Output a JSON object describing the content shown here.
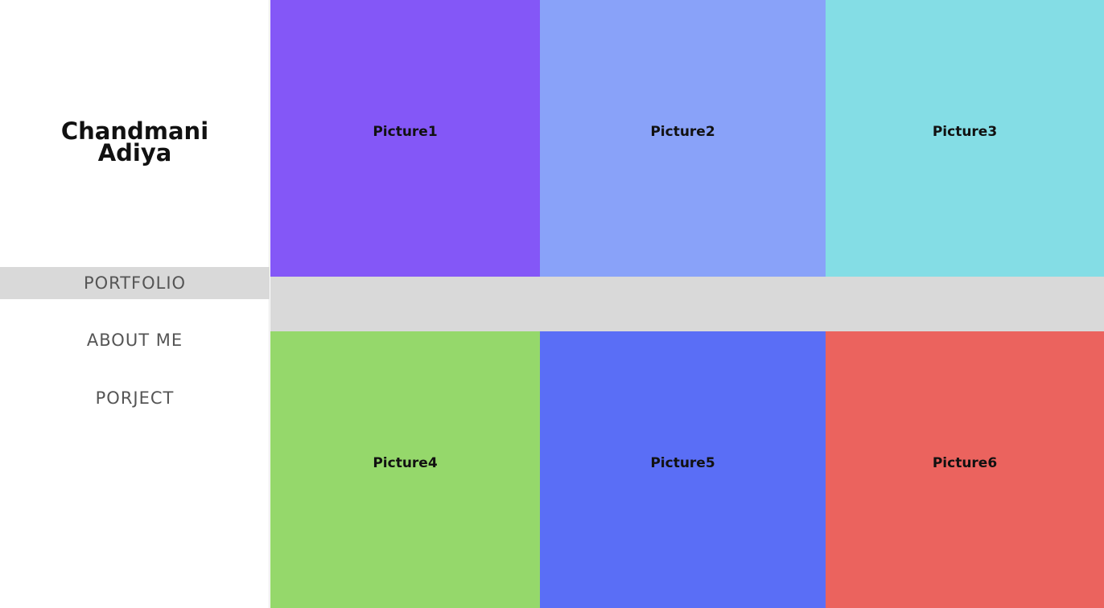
{
  "brand": {
    "line1": "Chandmani",
    "line2": "Adiya"
  },
  "nav": {
    "items": [
      {
        "label": "PORTFOLIO",
        "active": true
      },
      {
        "label": "ABOUT ME",
        "active": false
      },
      {
        "label": "PORJECT",
        "active": false
      }
    ]
  },
  "gallery": {
    "tiles": [
      {
        "label": "Picture1",
        "color": "#8457f7"
      },
      {
        "label": "Picture2",
        "color": "#89a2f9"
      },
      {
        "label": "Picture3",
        "color": "#84dde5"
      },
      {
        "label": "Picture4",
        "color": "#95d86b"
      },
      {
        "label": "Picture5",
        "color": "#5a6ef6"
      },
      {
        "label": "Picture6",
        "color": "#eb635e"
      }
    ],
    "gap_color": "#d9d9d9"
  },
  "colors": {
    "active_nav_bg": "#d9d9d9",
    "nav_text": "#555555",
    "brand_text": "#111111"
  }
}
